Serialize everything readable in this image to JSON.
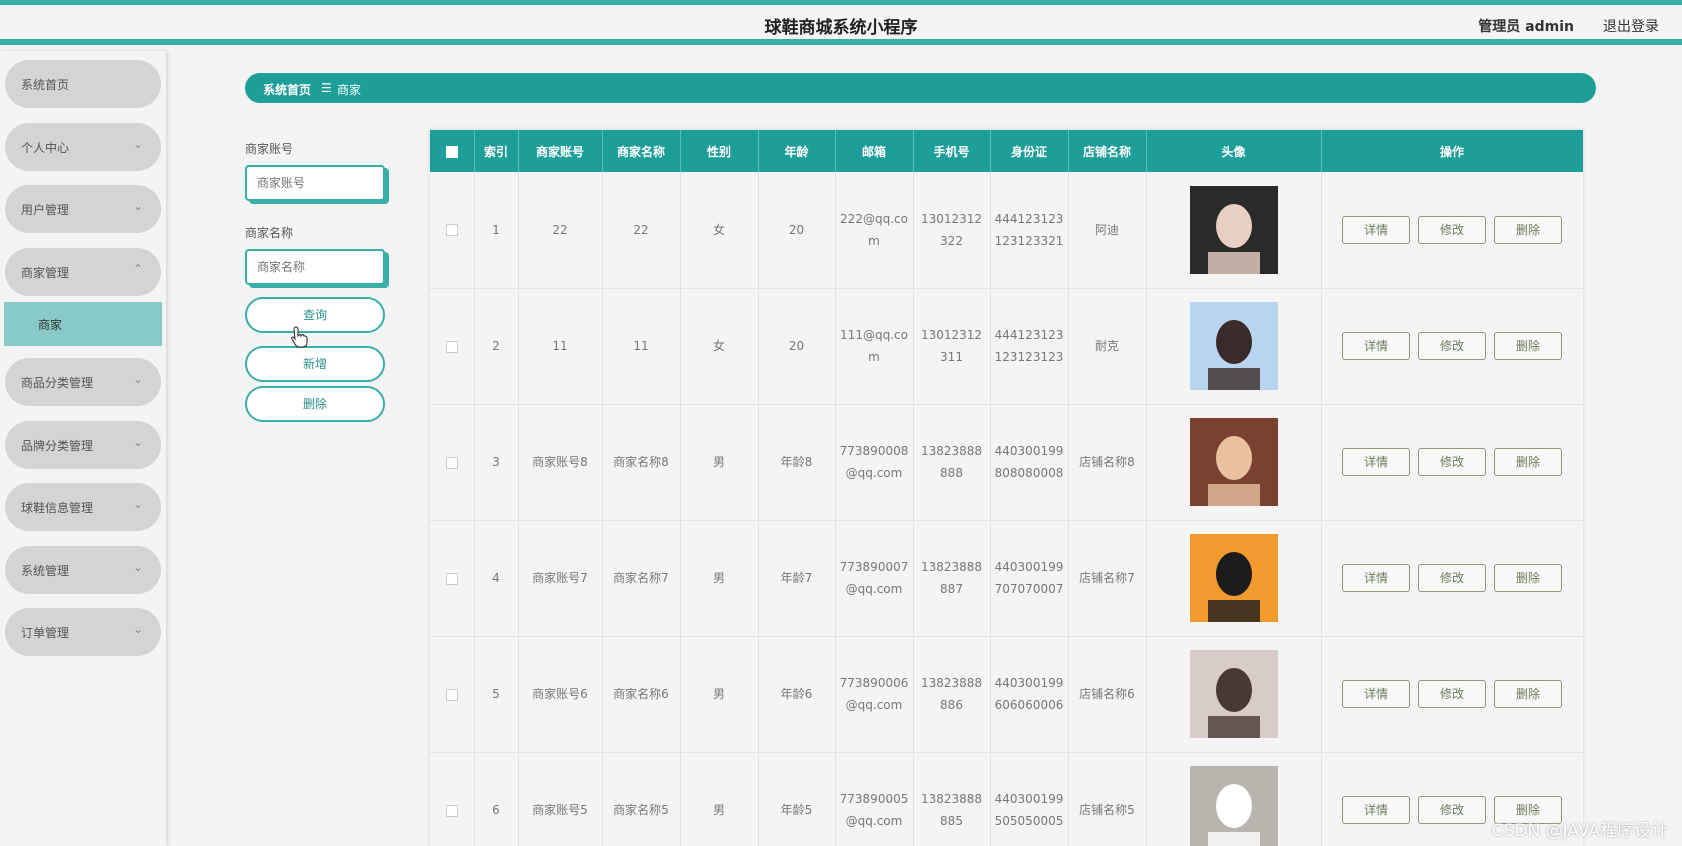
{
  "header": {
    "title": "球鞋商城系统小程序",
    "user": "管理员 admin",
    "logout": "退出登录"
  },
  "sidebar": {
    "items": [
      {
        "label": "系统首页",
        "chevron": ""
      },
      {
        "label": "个人中心",
        "chevron": "⌄"
      },
      {
        "label": "用户管理",
        "chevron": "⌄"
      },
      {
        "label": "商家管理",
        "chevron": "⌃"
      },
      {
        "label": "商品分类管理",
        "chevron": "⌄"
      },
      {
        "label": "品牌分类管理",
        "chevron": "⌄"
      },
      {
        "label": "球鞋信息管理",
        "chevron": "⌄"
      },
      {
        "label": "系统管理",
        "chevron": "⌄"
      },
      {
        "label": "订单管理",
        "chevron": "⌄"
      }
    ],
    "submenu": "商家"
  },
  "breadcrumb": {
    "home": "系统首页",
    "sep": "☰",
    "current": "商家"
  },
  "search": {
    "account_label": "商家账号",
    "account_placeholder": "商家账号",
    "name_label": "商家名称",
    "name_placeholder": "商家名称",
    "query": "查询",
    "add": "新增",
    "delete": "删除"
  },
  "table": {
    "columns": [
      "索引",
      "商家账号",
      "商家名称",
      "性别",
      "年龄",
      "邮箱",
      "手机号",
      "身份证",
      "店铺名称",
      "头像",
      "操作"
    ],
    "actions": {
      "detail": "详情",
      "edit": "修改",
      "delete": "删除"
    },
    "rows": [
      {
        "idx": "1",
        "account": "22",
        "name": "22",
        "gender": "女",
        "age": "20",
        "email": "222@qq.com",
        "phone": "13012312322",
        "id_card": "444123123123123321",
        "shop": "阿迪"
      },
      {
        "idx": "2",
        "account": "11",
        "name": "11",
        "gender": "女",
        "age": "20",
        "email": "111@qq.com",
        "phone": "13012312311",
        "id_card": "444123123123123123",
        "shop": "耐克"
      },
      {
        "idx": "3",
        "account": "商家账号8",
        "name": "商家名称8",
        "gender": "男",
        "age": "年龄8",
        "email": "773890008@qq.com",
        "phone": "13823888888",
        "id_card": "440300199808080008",
        "shop": "店铺名称8"
      },
      {
        "idx": "4",
        "account": "商家账号7",
        "name": "商家名称7",
        "gender": "男",
        "age": "年龄7",
        "email": "773890007@qq.com",
        "phone": "13823888887",
        "id_card": "440300199707070007",
        "shop": "店铺名称7"
      },
      {
        "idx": "5",
        "account": "商家账号6",
        "name": "商家名称6",
        "gender": "男",
        "age": "年龄6",
        "email": "773890006@qq.com",
        "phone": "13823888886",
        "id_card": "440300199606060006",
        "shop": "店铺名称6"
      },
      {
        "idx": "6",
        "account": "商家账号5",
        "name": "商家名称5",
        "gender": "男",
        "age": "年龄5",
        "email": "773890005@qq.com",
        "phone": "13823888885",
        "id_card": "440300199505050005",
        "shop": "店铺名称5"
      }
    ]
  },
  "watermark": "CSDN @JAVA程序设计",
  "colors": {
    "accent": "#1d9e99",
    "accent_light": "#3aaea8",
    "submenu": "#88cac7"
  }
}
